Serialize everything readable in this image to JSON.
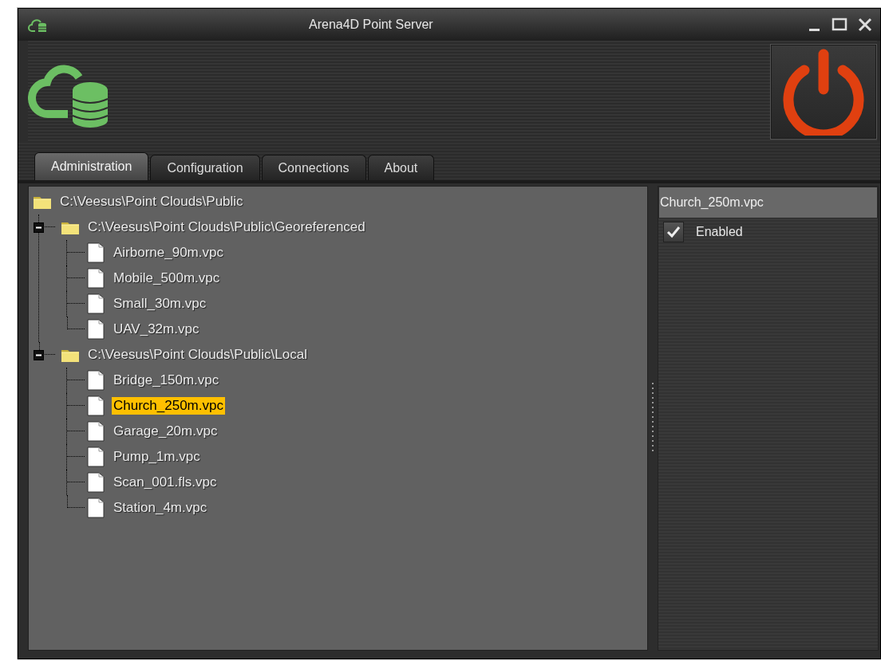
{
  "window": {
    "title": "Arena4D Point Server"
  },
  "tabs": [
    {
      "label": "Administration",
      "selected": true
    },
    {
      "label": "Configuration",
      "selected": false
    },
    {
      "label": "Connections",
      "selected": false
    },
    {
      "label": "About",
      "selected": false
    }
  ],
  "tree": {
    "label": "C:\\Veesus\\Point Clouds\\Public",
    "kind": "folder",
    "selected": false,
    "children": [
      {
        "label": "C:\\Veesus\\Point Clouds\\Public\\Georeferenced",
        "kind": "folder",
        "expanded": true,
        "selected": false,
        "children": [
          {
            "label": "Airborne_90m.vpc",
            "kind": "file",
            "selected": false
          },
          {
            "label": "Mobile_500m.vpc",
            "kind": "file",
            "selected": false
          },
          {
            "label": "Small_30m.vpc",
            "kind": "file",
            "selected": false
          },
          {
            "label": "UAV_32m.vpc",
            "kind": "file",
            "selected": false
          }
        ]
      },
      {
        "label": "C:\\Veesus\\Point Clouds\\Public\\Local",
        "kind": "folder",
        "expanded": true,
        "selected": false,
        "children": [
          {
            "label": "Bridge_150m.vpc",
            "kind": "file",
            "selected": false
          },
          {
            "label": "Church_250m.vpc",
            "kind": "file",
            "selected": true
          },
          {
            "label": "Garage_20m.vpc",
            "kind": "file",
            "selected": false
          },
          {
            "label": "Pump_1m.vpc",
            "kind": "file",
            "selected": false
          },
          {
            "label": "Scan_001.fls.vpc",
            "kind": "file",
            "selected": false
          },
          {
            "label": "Station_4m.vpc",
            "kind": "file",
            "selected": false
          }
        ]
      }
    ]
  },
  "details": {
    "name": "Church_250m.vpc",
    "enabled": {
      "label": "Enabled",
      "checked": true
    }
  }
}
